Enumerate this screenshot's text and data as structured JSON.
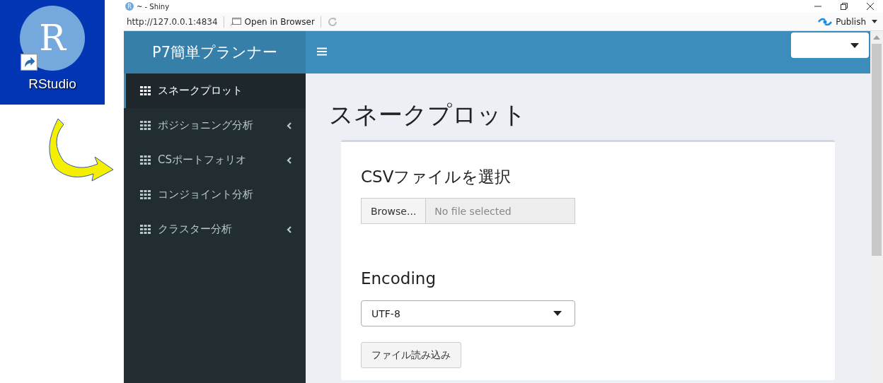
{
  "desktop_shortcut": {
    "logo_letter": "R",
    "label": "RStudio"
  },
  "window": {
    "app_letter": "R",
    "title": "~ - Shiny",
    "url": "http://127.0.0.1:4834",
    "open_in_browser": "Open in Browser",
    "publish": "Publish"
  },
  "app": {
    "brand": "P7簡単プランナー",
    "sidebar": {
      "items": [
        {
          "label": "スネークプロット",
          "selected": true,
          "expandable": false
        },
        {
          "label": "ポジショニング分析",
          "selected": false,
          "expandable": true
        },
        {
          "label": "CSポートフォリオ",
          "selected": false,
          "expandable": true
        },
        {
          "label": "コンジョイント分析",
          "selected": false,
          "expandable": false
        },
        {
          "label": "クラスター分析",
          "selected": false,
          "expandable": true
        }
      ]
    },
    "page_title": "スネークプロット",
    "card": {
      "file_label": "CSVファイルを選択",
      "browse": "Browse...",
      "file_placeholder": "No file selected",
      "encoding_label": "Encoding",
      "encoding_value": "UTF-8",
      "load_button": "ファイル読み込み"
    }
  }
}
